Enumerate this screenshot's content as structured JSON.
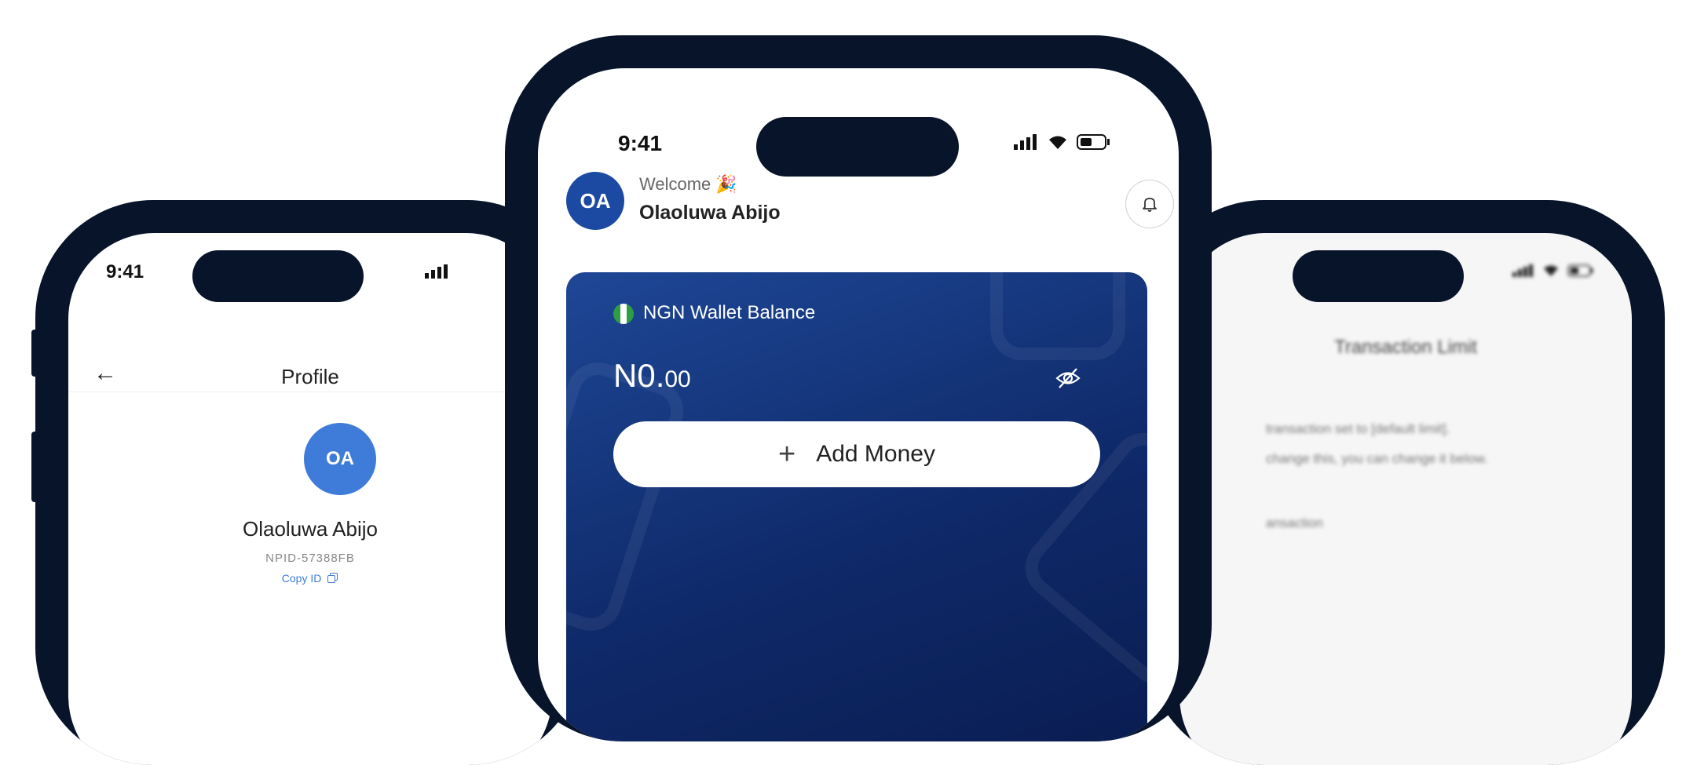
{
  "left_phone": {
    "status_time": "9:41",
    "header_title": "Profile",
    "back_glyph": "←",
    "avatar_initials": "OA",
    "name": "Olaoluwa Abijo",
    "npid": "NPID-57388FB",
    "copy_text": "Copy ID"
  },
  "center_phone": {
    "status_time": "9:41",
    "avatar_initials": "OA",
    "welcome": "Welcome",
    "welcome_emoji": "🎉",
    "user_name": "Olaoluwa Abijo",
    "wallet": {
      "label": "NGN Wallet Balance",
      "balance_main": "N0.",
      "balance_decimal": "00",
      "add_money_label": "Add Money",
      "add_money_icon": "+"
    }
  },
  "right_phone": {
    "title": "Transaction Limit",
    "line1": "transaction set to [default limit].",
    "line2": "change this, you can change it below.",
    "section": "ansaction"
  },
  "colors": {
    "phone_frame": "#07142a",
    "wallet_card": "#1e4796",
    "avatar_blue": "#3f7cd9"
  }
}
